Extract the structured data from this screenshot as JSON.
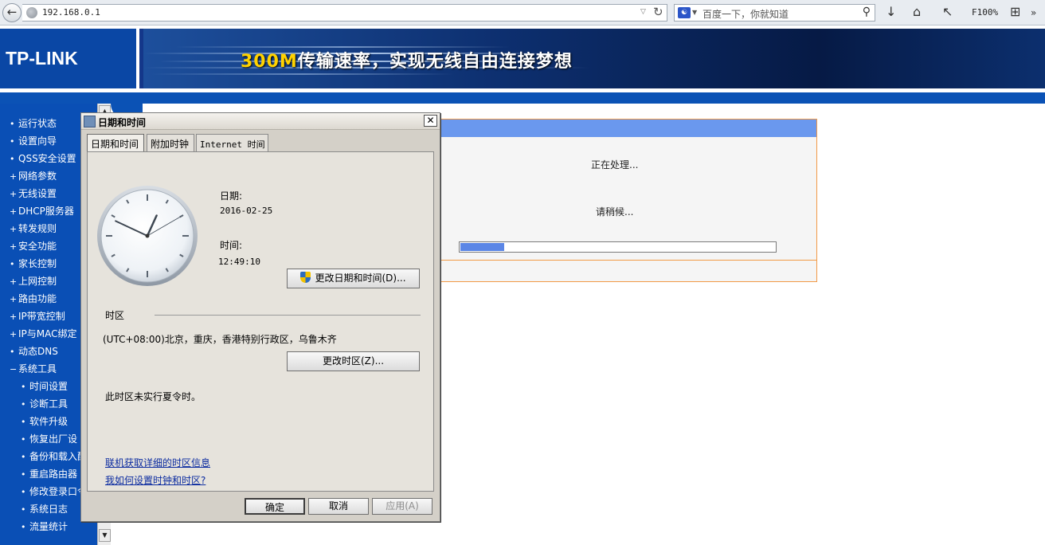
{
  "browser": {
    "url": "192.168.0.1",
    "search_placeholder": "百度一下，你就知道",
    "zoom": "F100%"
  },
  "banner": {
    "logo": "TP-LINK",
    "slogan_num": "300M",
    "slogan_text": "传输速率，实现无线自由连接梦想"
  },
  "nav": {
    "items": [
      {
        "mark": "•",
        "label": "运行状态"
      },
      {
        "mark": "•",
        "label": "设置向导"
      },
      {
        "mark": "•",
        "label": "QSS安全设置"
      },
      {
        "mark": "+",
        "label": "网络参数"
      },
      {
        "mark": "+",
        "label": "无线设置"
      },
      {
        "mark": "+",
        "label": "DHCP服务器"
      },
      {
        "mark": "+",
        "label": "转发规则"
      },
      {
        "mark": "+",
        "label": "安全功能"
      },
      {
        "mark": "•",
        "label": "家长控制"
      },
      {
        "mark": "+",
        "label": "上网控制"
      },
      {
        "mark": "+",
        "label": "路由功能"
      },
      {
        "mark": "+",
        "label": "IP带宽控制"
      },
      {
        "mark": "+",
        "label": "IP与MAC绑定"
      },
      {
        "mark": "•",
        "label": "动态DNS"
      },
      {
        "mark": "−",
        "label": "系统工具"
      }
    ],
    "sub_items": [
      {
        "mark": "•",
        "label": "时间设置"
      },
      {
        "mark": "•",
        "label": "诊断工具"
      },
      {
        "mark": "•",
        "label": "软件升级"
      },
      {
        "mark": "•",
        "label": "恢复出厂设"
      },
      {
        "mark": "•",
        "label": "备份和载入配"
      },
      {
        "mark": "•",
        "label": "重启路由器"
      },
      {
        "mark": "•",
        "label": "修改登录口令"
      },
      {
        "mark": "•",
        "label": "系统日志"
      },
      {
        "mark": "•",
        "label": "流量统计"
      }
    ]
  },
  "progress": {
    "processing_text": "正在处理...",
    "wait_text": "请稍候...",
    "percent": 14
  },
  "dialog": {
    "title": "日期和时间",
    "close": "✕",
    "tabs": [
      "日期和时间",
      "附加时钟",
      "Internet 时间"
    ],
    "date_label": "日期:",
    "date_value": "2016-02-25",
    "time_label": "时间:",
    "time_value": "12:49:10",
    "change_datetime_button": "更改日期和时间(D)...",
    "timezone_heading": "时区",
    "timezone_value": "(UTC+08:00)北京，重庆，香港特别行政区，乌鲁木齐",
    "change_timezone_button": "更改时区(Z)...",
    "dst_note": "此时区未实行夏令时。",
    "link_timezone_info": "联机获取详细的时区信息",
    "link_how_to": "我如何设置时钟和时区?",
    "ok_button": "确定",
    "cancel_button": "取消",
    "apply_button": "应用(A)"
  },
  "colors": {
    "nav_bg": "#0a4fb5",
    "panel_head": "#6a98ee",
    "panel_border": "#f29a46",
    "progress_fill": "#5b86e6"
  }
}
